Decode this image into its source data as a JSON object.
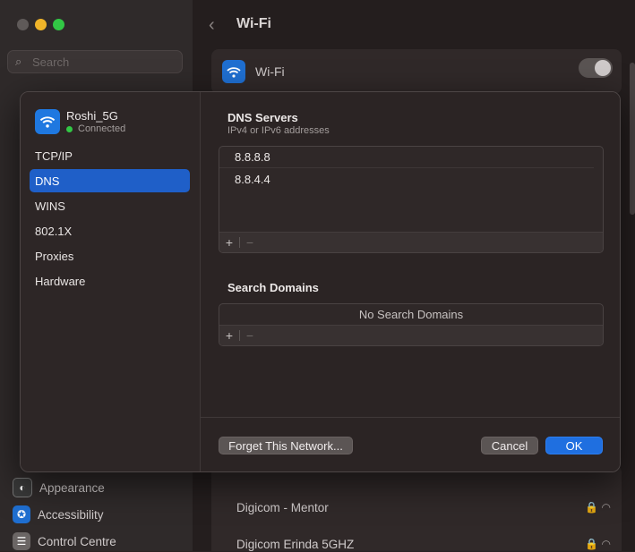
{
  "window": {
    "title": "Wi-Fi"
  },
  "sidebar": {
    "search_placeholder": "Search",
    "items": [
      {
        "label": "Appearance",
        "icon": "appearance-icon"
      },
      {
        "label": "Accessibility",
        "icon": "accessibility-icon"
      },
      {
        "label": "Control Centre",
        "icon": "control-centre-icon"
      }
    ]
  },
  "wifi_card": {
    "label": "Wi-Fi"
  },
  "networks": [
    {
      "name": "Digicom - Mentor"
    },
    {
      "name": "Digicom Erinda 5GHZ"
    }
  ],
  "modal": {
    "network": {
      "name": "Roshi_5G",
      "status": "Connected"
    },
    "tabs": [
      {
        "label": "TCP/IP",
        "active": false
      },
      {
        "label": "DNS",
        "active": true
      },
      {
        "label": "WINS",
        "active": false
      },
      {
        "label": "802.1X",
        "active": false
      },
      {
        "label": "Proxies",
        "active": false
      },
      {
        "label": "Hardware",
        "active": false
      }
    ],
    "dns_servers": {
      "title": "DNS Servers",
      "subtitle": "IPv4 or IPv6 addresses",
      "entries": [
        "8.8.8.8",
        "8.8.4.4"
      ]
    },
    "search_domains": {
      "title": "Search Domains",
      "empty_text": "No Search Domains"
    },
    "controls": {
      "add": "+",
      "remove": "−"
    },
    "buttons": {
      "forget": "Forget This Network...",
      "cancel": "Cancel",
      "ok": "OK"
    }
  },
  "colors": {
    "accent": "#1f6fe0",
    "selected_tab": "#1f5fc8",
    "connected": "#32c845"
  }
}
